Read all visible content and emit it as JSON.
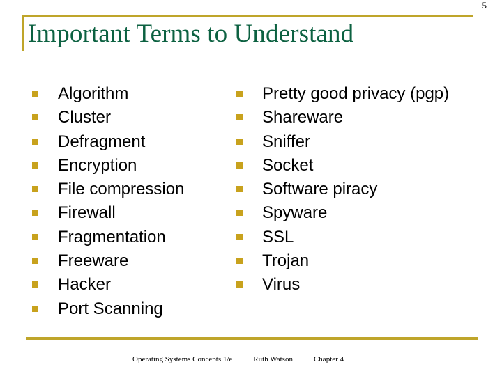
{
  "slide": {
    "title": "Important Terms to Understand",
    "accent_color": "#bfa52a",
    "bullet_color": "#c8a21d",
    "title_color": "#0c6141",
    "text_color": "#000000",
    "background_color": "#ffffff"
  },
  "columns": {
    "left": [
      {
        "label": "Algorithm"
      },
      {
        "label": "Cluster"
      },
      {
        "label": "Defragment"
      },
      {
        "label": "Encryption"
      },
      {
        "label": "File compression"
      },
      {
        "label": "Firewall"
      },
      {
        "label": "Fragmentation"
      },
      {
        "label": "Freeware"
      },
      {
        "label": "Hacker"
      },
      {
        "label": "Port Scanning"
      }
    ],
    "right": [
      {
        "label": "Pretty good privacy (pgp)"
      },
      {
        "label": "Shareware"
      },
      {
        "label": "Sniffer"
      },
      {
        "label": "Socket"
      },
      {
        "label": "Software piracy"
      },
      {
        "label": "Spyware"
      },
      {
        "label": "SSL"
      },
      {
        "label": "Trojan"
      },
      {
        "label": "Virus"
      }
    ]
  },
  "footer": {
    "course": "Operating Systems Concepts 1/e",
    "author": "Ruth Watson",
    "chapter": "Chapter 4",
    "slide_number": "5"
  }
}
